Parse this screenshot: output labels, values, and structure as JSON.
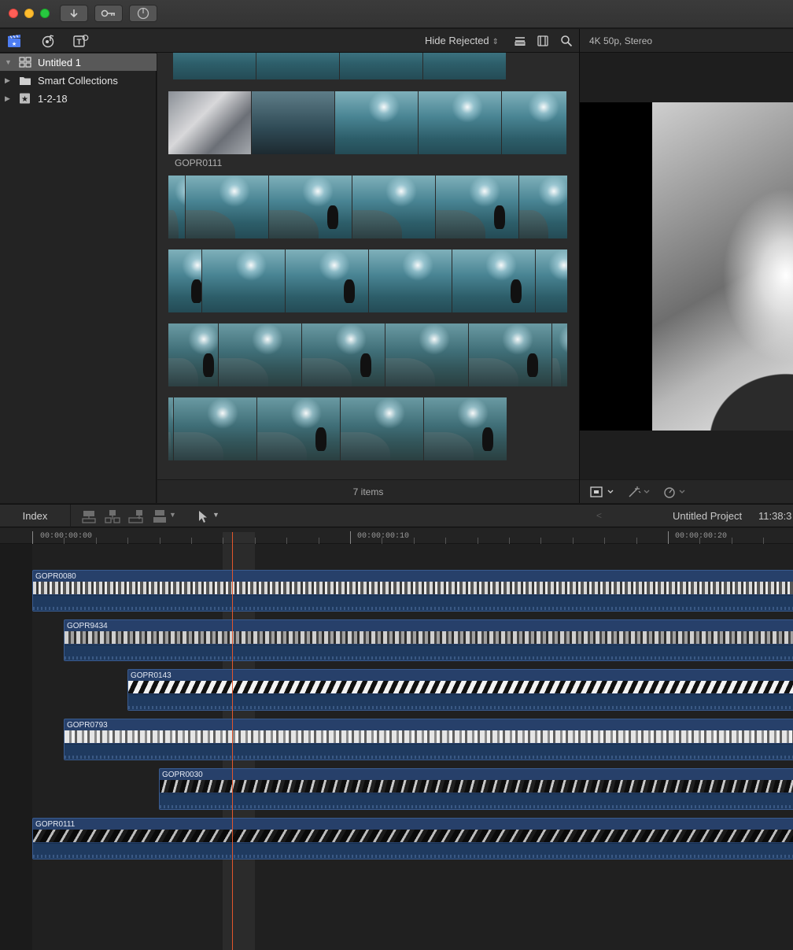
{
  "titlebar": {
    "buttons": [
      "import-icon",
      "keywords-icon",
      "background-tasks-icon"
    ]
  },
  "toolbar": {
    "left_icons": [
      "libraries-icon",
      "photos-audio-icon",
      "titles-generators-icon"
    ],
    "filter_label": "Hide Rejected",
    "right_icons": [
      "clip-appearance-icon",
      "filmstrip-icon",
      "search-icon"
    ],
    "viewer_format": "4K 50p, Stereo"
  },
  "library": {
    "items": [
      {
        "label": "Untitled 1",
        "icon": "library-icon",
        "selected": true,
        "expanded": true
      },
      {
        "label": "Smart Collections",
        "icon": "folder-icon",
        "selected": false,
        "expanded": false
      },
      {
        "label": "1-2-18",
        "icon": "event-star-icon",
        "selected": false,
        "expanded": false
      }
    ]
  },
  "browser": {
    "clip_label": "GOPR0111",
    "items_count": "7 items"
  },
  "viewer_controls": [
    "transform-icon",
    "enhance-icon",
    "retime-icon"
  ],
  "timeline_toolbar": {
    "index_label": "Index",
    "project_name": "Untitled Project",
    "project_time": "11:38:3"
  },
  "timeline": {
    "timecodes": [
      "00:00:00:00",
      "00:00:00:10",
      "00:00:00:20"
    ],
    "clips": [
      {
        "name": "GOPR0080"
      },
      {
        "name": "GOPR9434"
      },
      {
        "name": "GOPR0143"
      },
      {
        "name": "GOPR0793"
      },
      {
        "name": "GOPR0030"
      },
      {
        "name": "GOPR0111"
      }
    ]
  },
  "colors": {
    "playhead": "#e2562c",
    "clip_blue": "#27406a",
    "selection": "#585858"
  }
}
